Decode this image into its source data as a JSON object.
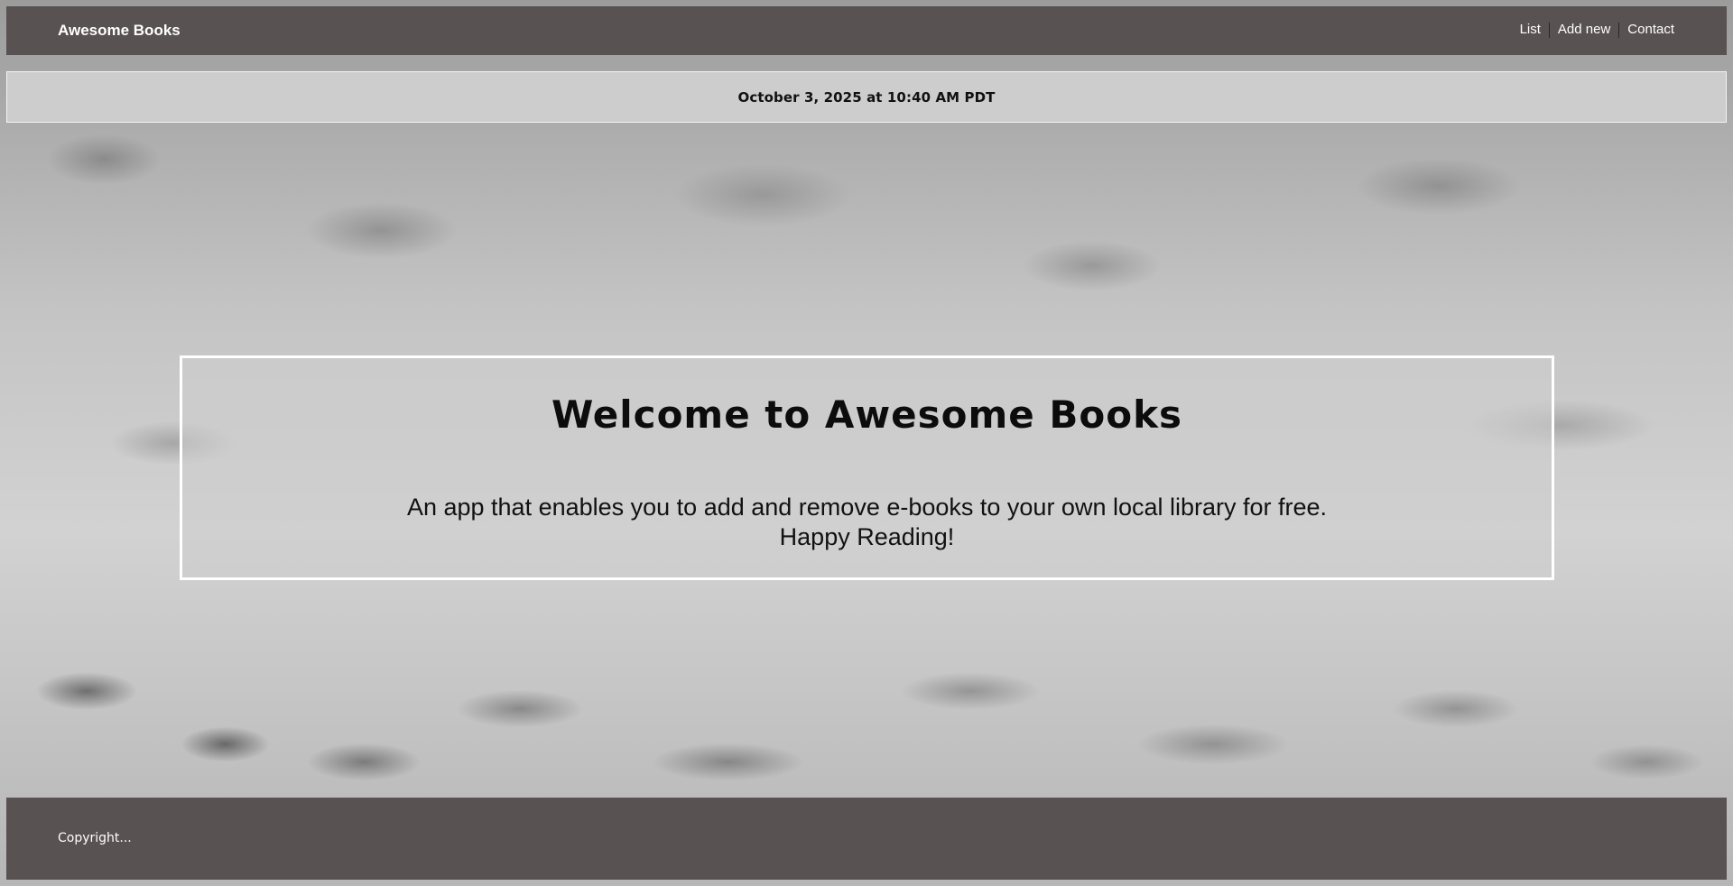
{
  "header": {
    "brand": "Awesome Books",
    "nav": [
      {
        "label": "List"
      },
      {
        "label": "Add new"
      },
      {
        "label": "Contact"
      }
    ]
  },
  "datebar": {
    "date": "October 3, 2025 at 10:40 AM PDT"
  },
  "welcome": {
    "title": "Welcome to Awesome Books",
    "line1": "An app that enables you to add and remove e-books to your own local library for free.",
    "line2": "Happy Reading!"
  },
  "footer": {
    "copyright": "Copyright..."
  },
  "colors": {
    "bar_background": "#595252",
    "datebar_background": "#cdcdcd",
    "welcome_border": "#ffffff",
    "text_light": "#ffffff",
    "text_dark": "#111111"
  }
}
